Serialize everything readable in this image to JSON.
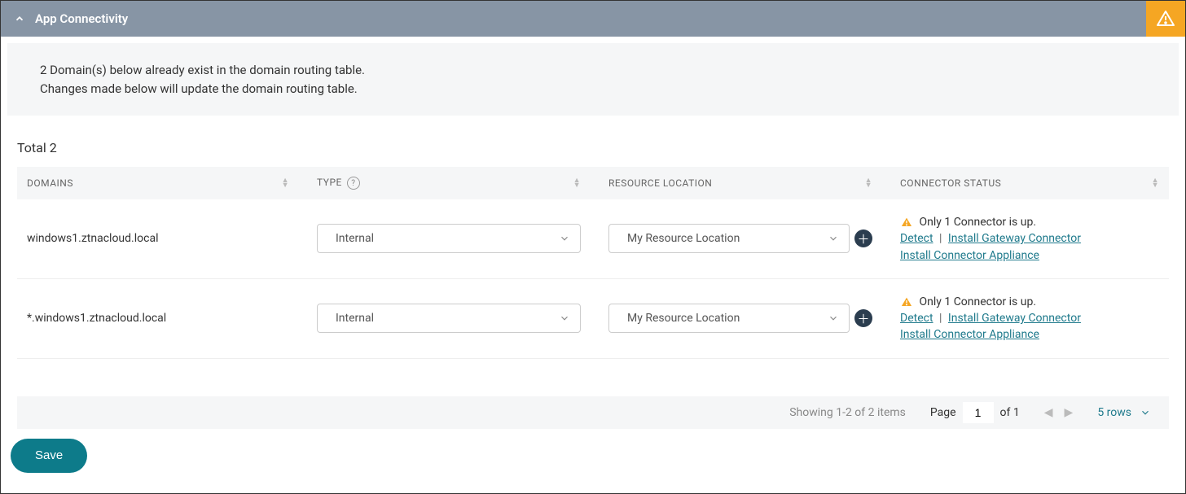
{
  "header": {
    "title": "App Connectivity"
  },
  "info": {
    "line1": "2 Domain(s) below already exist in the domain routing table.",
    "line2": "Changes made below will update the domain routing table."
  },
  "total": {
    "label": "Total 2"
  },
  "columns": {
    "domains": "Domains",
    "type": "Type",
    "location": "Resource Location",
    "status": "Connector Status"
  },
  "rows": [
    {
      "domain": "windows1.ztnacloud.local",
      "type": "Internal",
      "location": "My Resource Location",
      "status": {
        "message": "Only 1 Connector is up.",
        "detect": "Detect",
        "install_gw": "Install Gateway Connector",
        "install_app": "Install Connector Appliance"
      }
    },
    {
      "domain": "*.windows1.ztnacloud.local",
      "type": "Internal",
      "location": "My Resource Location",
      "status": {
        "message": "Only 1 Connector is up.",
        "detect": "Detect",
        "install_gw": "Install Gateway Connector",
        "install_app": "Install Connector Appliance"
      }
    }
  ],
  "footer": {
    "showing": "Showing 1-2 of 2 items",
    "page_label": "Page",
    "page_value": "1",
    "of_label": "of 1",
    "rows_label": "5 rows"
  },
  "actions": {
    "save": "Save"
  }
}
